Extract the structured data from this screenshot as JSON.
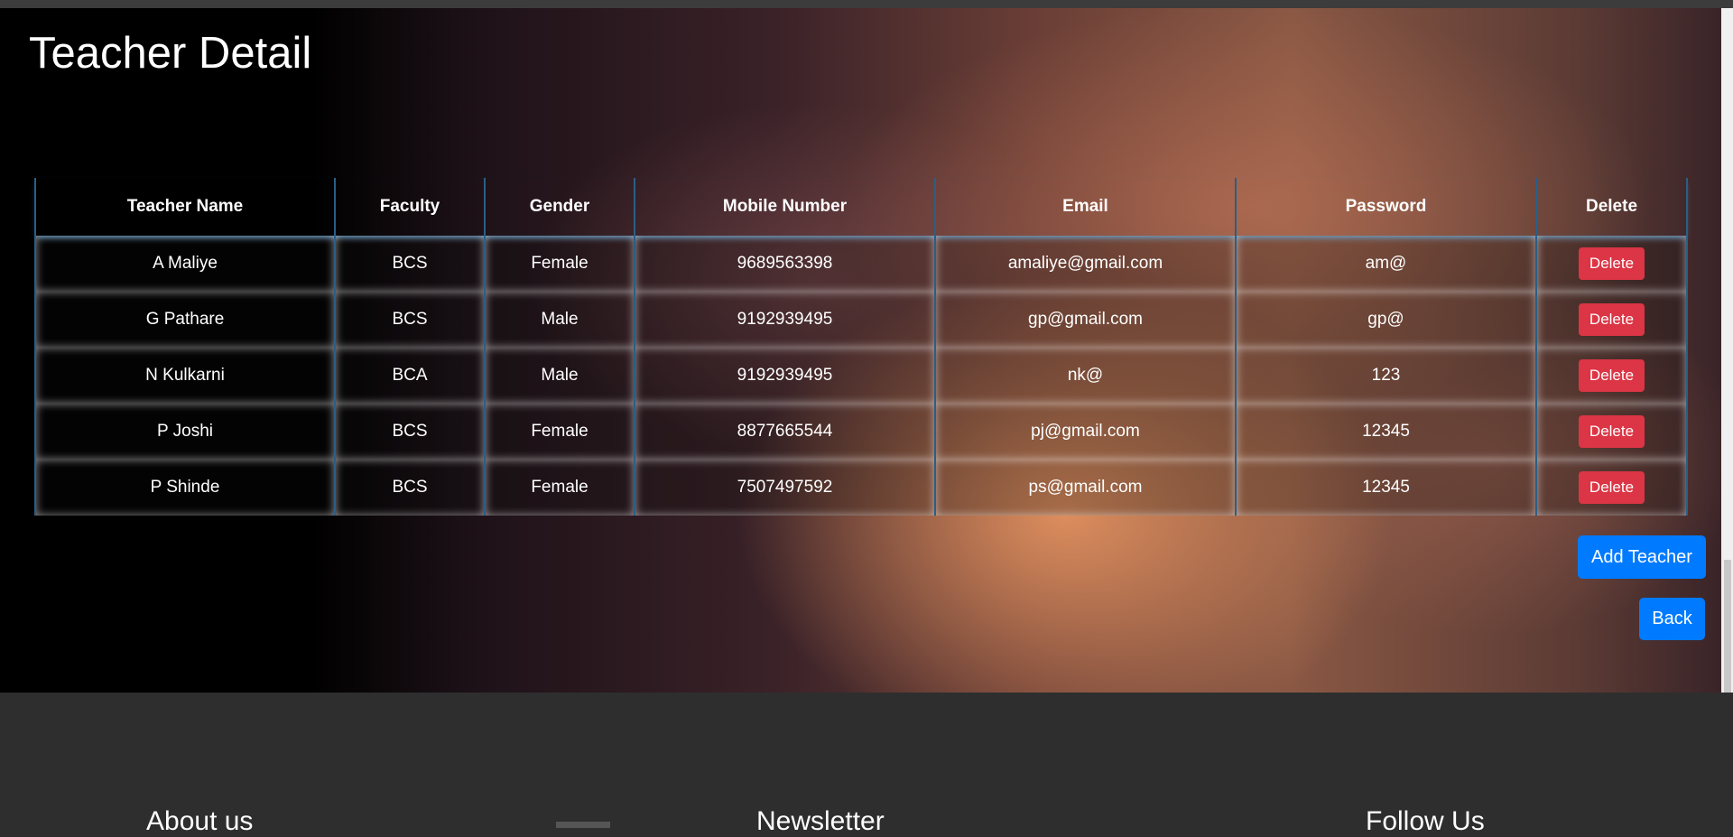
{
  "page": {
    "title": "Teacher Detail"
  },
  "table": {
    "headers": [
      "Teacher Name",
      "Faculty",
      "Gender",
      "Mobile Number",
      "Email",
      "Password",
      "Delete"
    ],
    "rows": [
      {
        "name": "A Maliye",
        "faculty": "BCS",
        "gender": "Female",
        "mobile": "9689563398",
        "email": "amaliye@gmail.com",
        "password": "am@",
        "action": "Delete"
      },
      {
        "name": "G Pathare",
        "faculty": "BCS",
        "gender": "Male",
        "mobile": "9192939495",
        "email": "gp@gmail.com",
        "password": "gp@",
        "action": "Delete"
      },
      {
        "name": "N Kulkarni",
        "faculty": "BCA",
        "gender": "Male",
        "mobile": "9192939495",
        "email": "nk@",
        "password": "123",
        "action": "Delete"
      },
      {
        "name": "P Joshi",
        "faculty": "BCS",
        "gender": "Female",
        "mobile": "8877665544",
        "email": "pj@gmail.com",
        "password": "12345",
        "action": "Delete"
      },
      {
        "name": "P Shinde",
        "faculty": "BCS",
        "gender": "Female",
        "mobile": "7507497592",
        "email": "ps@gmail.com",
        "password": "12345",
        "action": "Delete"
      }
    ]
  },
  "buttons": {
    "add_teacher": "Add Teacher",
    "back": "Back"
  },
  "footer": {
    "about": "About us",
    "newsletter": "Newsletter",
    "follow": "Follow Us"
  },
  "colors": {
    "primary": "#007bff",
    "danger": "#dc3545",
    "footer_bg": "#2e2e2e",
    "table_border": "#2a5f86"
  }
}
